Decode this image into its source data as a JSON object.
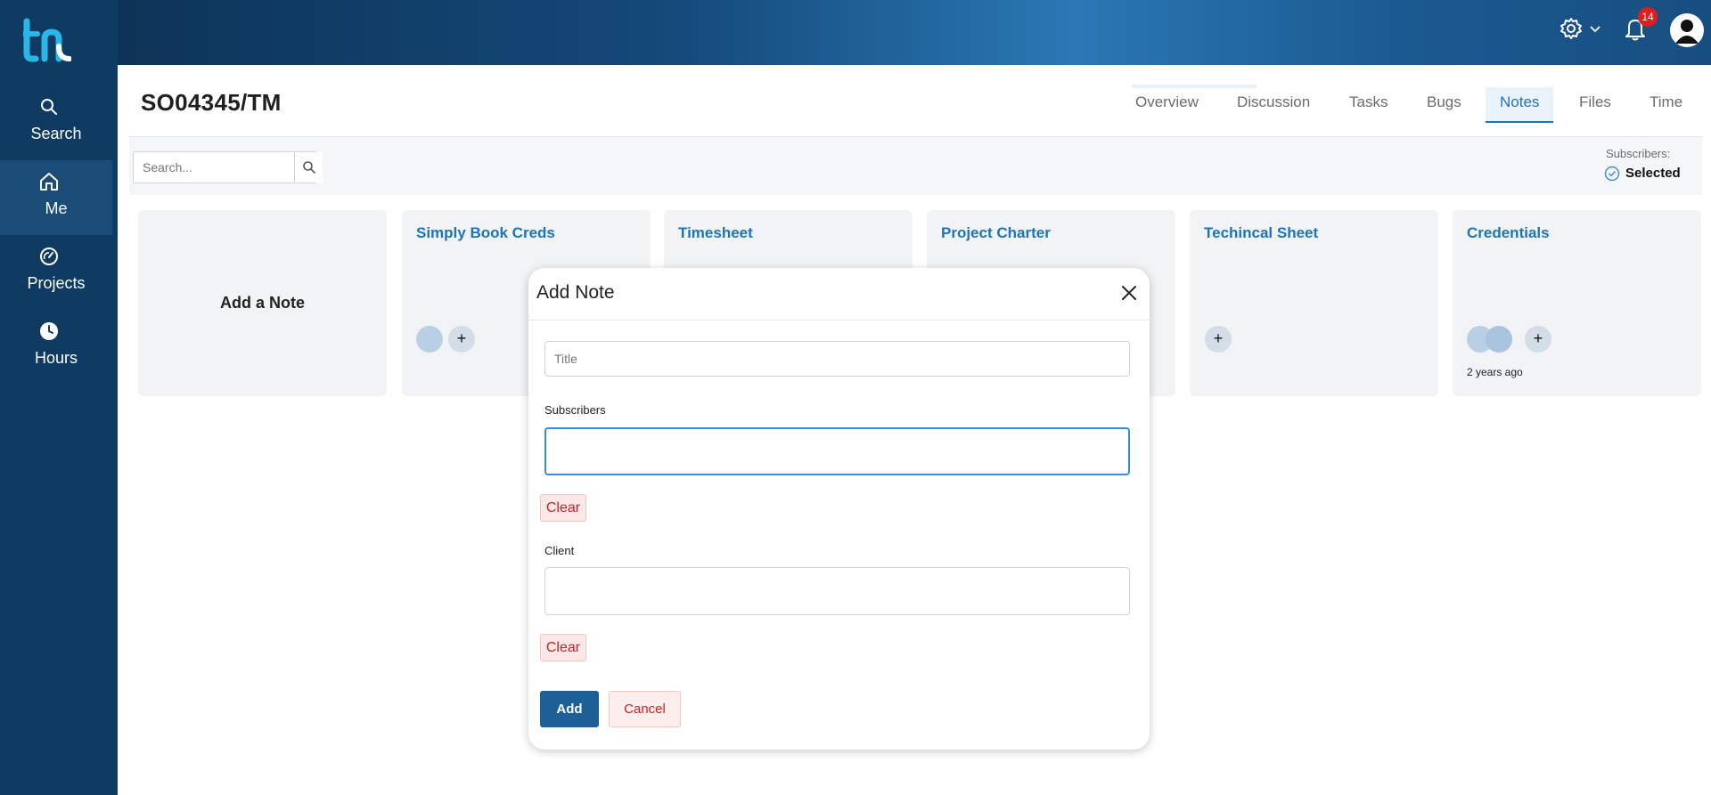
{
  "sidebar": {
    "logo": "th",
    "items": [
      {
        "label": "Search",
        "icon": "search-icon"
      },
      {
        "label": "Me",
        "icon": "home-icon"
      },
      {
        "label": "Projects",
        "icon": "gauge-icon"
      },
      {
        "label": "Hours",
        "icon": "clock-icon"
      }
    ]
  },
  "header": {
    "notification_count": "14",
    "icons": [
      "gear-icon",
      "chevron-down-icon",
      "bell-icon",
      "user-avatar-icon"
    ]
  },
  "page": {
    "title": "SO04345/TM",
    "tabs": [
      "Overview",
      "Discussion",
      "Tasks",
      "Bugs",
      "Notes",
      "Files",
      "Time"
    ],
    "active_tab": "Notes"
  },
  "toolbar": {
    "search_placeholder": "Search...",
    "subscribers_label": "Subscribers:",
    "subscribers_value": "Selected"
  },
  "cards": {
    "add_note_label": "Add a Note",
    "notes": [
      {
        "title": "Simply Book Creds",
        "plus": "+"
      },
      {
        "title": "Timesheet"
      },
      {
        "title": "Project Charter"
      },
      {
        "title": "Techincal Sheet",
        "plus": "+"
      },
      {
        "title": "Credentials",
        "plus": "+",
        "updated": "2 years ago"
      }
    ]
  },
  "modal": {
    "title": "Add Note",
    "title_placeholder": "Title",
    "subscribers_label": "Subscribers",
    "client_label": "Client",
    "clear_label": "Clear",
    "add_label": "Add",
    "cancel_label": "Cancel"
  },
  "colors": {
    "sidebar_bg": "#0f3b63",
    "accent": "#1f73b7",
    "danger": "#c8232b",
    "primary_button": "#1d5f97"
  }
}
